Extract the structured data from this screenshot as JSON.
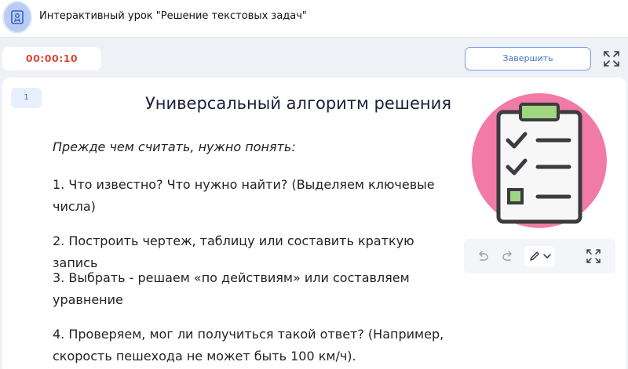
{
  "header": {
    "title": "Интерактивный урок \"Решение текстовых задач\"",
    "logo_icon": "document-badge-icon"
  },
  "controls": {
    "timer": "00:00:10",
    "finish_label": "Завершить",
    "expand_icon": "fullscreen-icon"
  },
  "slide": {
    "number": "1",
    "title": "Универсальный алгоритм решения",
    "intro": "Прежде чем считать, нужно понять:",
    "steps": [
      "1. Что известно? Что нужно найти? (Выделяем ключевые числа)",
      "2. Построить чертеж, таблицу или составить краткую запись",
      "3. Выбрать - решаем «по действиям» или составляем уравнение",
      "4. Проверяем, мог ли получиться такой ответ? (Например, скорость пешехода не может быть 100 км/ч)."
    ],
    "illustration_icon": "checklist-clipboard-icon"
  },
  "drawing_toolbar": {
    "icons": [
      "undo-icon",
      "redo-icon",
      "pen-icon",
      "chevron-down-icon",
      "fullscreen-icon"
    ]
  },
  "colors": {
    "accent_blue": "#4a6fd6",
    "timer_red": "#e0473c",
    "illustration_pink": "#f27aa6",
    "clipboard_green": "#9fd67f"
  }
}
